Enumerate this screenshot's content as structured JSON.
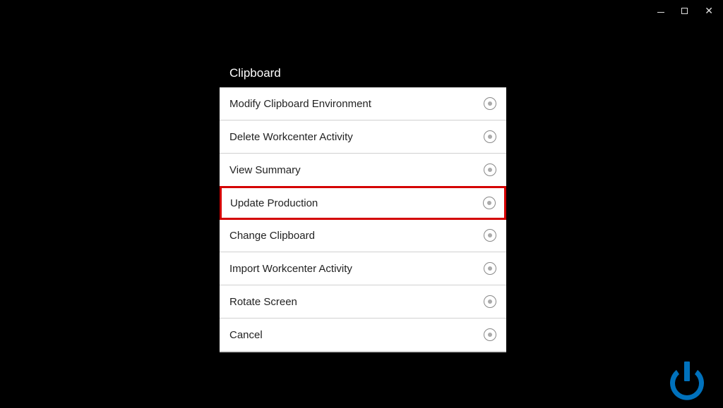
{
  "dialog": {
    "title": "Clipboard",
    "items": [
      {
        "label": "Modify Clipboard Environment",
        "highlighted": false
      },
      {
        "label": "Delete Workcenter Activity",
        "highlighted": false
      },
      {
        "label": "View Summary",
        "highlighted": false
      },
      {
        "label": "Update Production",
        "highlighted": true
      },
      {
        "label": "Change Clipboard",
        "highlighted": false
      },
      {
        "label": "Import Workcenter Activity",
        "highlighted": false
      },
      {
        "label": "Rotate Screen",
        "highlighted": false
      },
      {
        "label": "Cancel",
        "highlighted": false
      }
    ]
  },
  "colors": {
    "highlight": "#d40000",
    "logo": "#0071bc"
  }
}
